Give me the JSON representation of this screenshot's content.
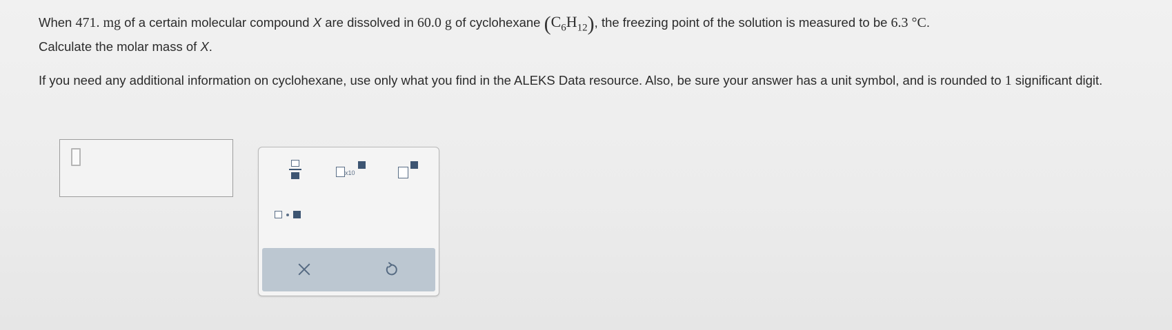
{
  "question": {
    "p1_a": "When ",
    "mass": "471. mg",
    "p1_b": " of a certain molecular compound ",
    "var_x1": "X",
    "p1_c": " are dissolved in ",
    "solvent_mass": "60.0 g",
    "p1_d": " of cyclohexane ",
    "formula_c": "C",
    "formula_c_sub": "6",
    "formula_h": "H",
    "formula_h_sub": "12",
    "p1_e": ", the freezing point of the solution is measured to be ",
    "temp": "6.3 °C",
    "p1_f": ".",
    "p2_a": "Calculate the molar mass of ",
    "var_x2": "X",
    "p2_b": ".",
    "p3_a": "If you need any additional information on cyclohexane, use only what you find in the ALEKS Data resource. Also, be sure your answer has a unit symbol, and is rounded to ",
    "sig_digits": "1",
    "p3_b": " significant digit."
  },
  "answer": {
    "value": ""
  },
  "palette": {
    "tools": [
      "fraction-icon",
      "scientific-notation-icon",
      "superscript-icon",
      "multiply-dot-icon"
    ],
    "sci_label": "x10",
    "actions": [
      "close-icon",
      "undo-icon"
    ]
  },
  "colors": {
    "icon": "#3d5572",
    "action_bar": "#bcc7d1",
    "background": "#ececec"
  }
}
